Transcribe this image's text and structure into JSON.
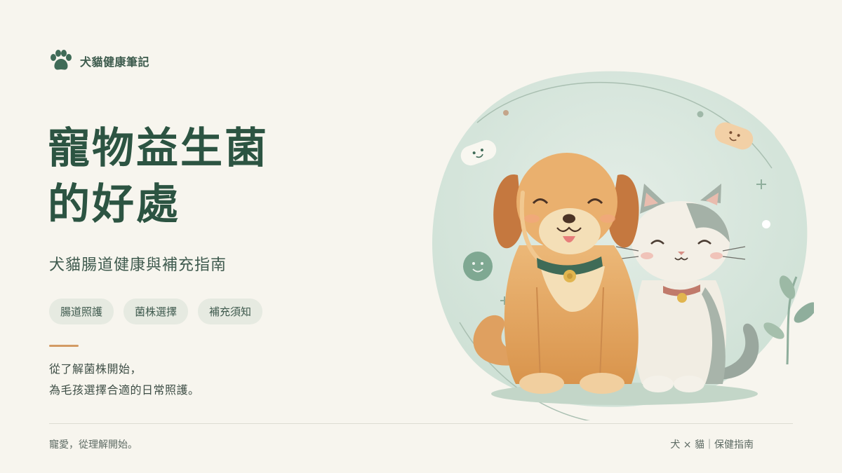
{
  "brand": {
    "name": "犬貓健康筆記",
    "icon": "paw-icon"
  },
  "hero": {
    "title_line1": "寵物益生菌",
    "title_line2": "的好處",
    "subtitle": "犬貓腸道健康與補充指南"
  },
  "tags": [
    "腸道照護",
    "菌株選擇",
    "補充須知"
  ],
  "description": {
    "line1": "從了解菌株開始，",
    "line2": "為毛孩選擇合適的日常照護。"
  },
  "footer": {
    "left": "寵愛，從理解開始。",
    "right": "犬 × 貓｜保健指南"
  },
  "colors": {
    "background": "#f7f5ee",
    "title": "#2c5442",
    "accent": "#d39b64",
    "tag_bg": "#e6eae1",
    "circle": "#d5e4da"
  }
}
